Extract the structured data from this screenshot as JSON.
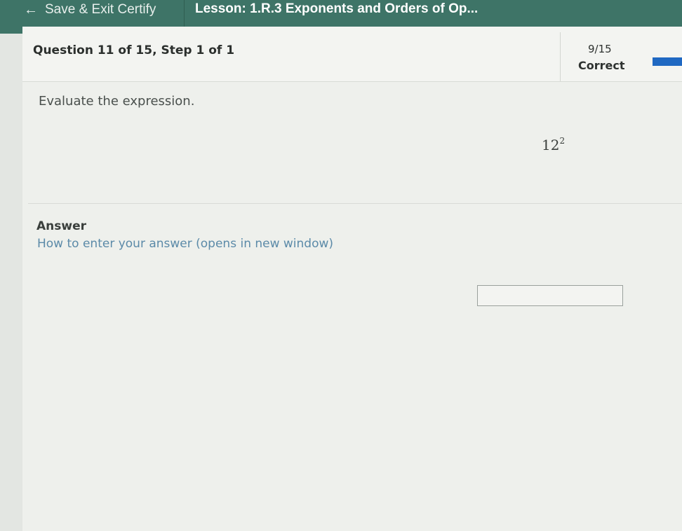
{
  "topbar": {
    "back_label": "Save & Exit Certify",
    "lesson_title": "Lesson: 1.R.3 Exponents and Orders of Op..."
  },
  "question": {
    "header": "Question 11 of 15, Step 1 of 1",
    "prompt": "Evaluate the expression.",
    "expression_base": "12",
    "expression_exponent": "2"
  },
  "score": {
    "fraction": "9/15",
    "status": "Correct",
    "bar_color": "#1f68c2"
  },
  "answer": {
    "label": "Answer",
    "help_link": "How to enter your answer (opens in new window)",
    "value": ""
  },
  "colors": {
    "topbar": "#3e7467",
    "link": "#5b8aa8"
  }
}
